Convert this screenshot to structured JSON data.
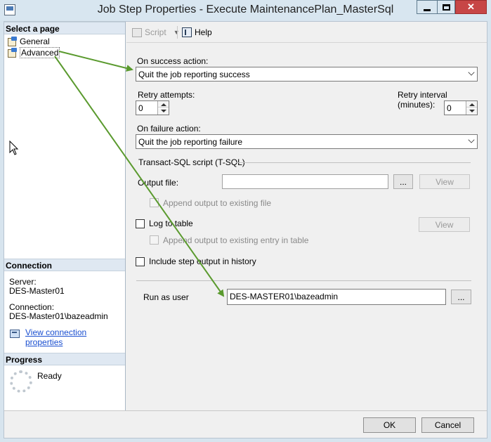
{
  "window": {
    "title": "Job Step Properties - Execute MaintenancePlan_MasterSql"
  },
  "left": {
    "select_page_header": "Select a page",
    "pages": [
      {
        "label": "General"
      },
      {
        "label": "Advanced"
      }
    ],
    "connection_header": "Connection",
    "server_label": "Server:",
    "server_value": "DES-Master01",
    "connection_label": "Connection:",
    "connection_value": "DES-Master01\\bazeadmin",
    "view_props_link": "View connection properties",
    "progress_header": "Progress",
    "progress_status": "Ready"
  },
  "toolbar": {
    "script_label": "Script",
    "help_label": "Help"
  },
  "form": {
    "on_success_label": "On success action:",
    "on_success_value": "Quit the job reporting success",
    "retry_attempts_label": "Retry attempts:",
    "retry_attempts_value": "0",
    "retry_interval_label": "Retry interval (minutes):",
    "retry_interval_value": "0",
    "on_failure_label": "On failure action:",
    "on_failure_value": "Quit the job reporting failure",
    "tsql_section": "Transact-SQL script (T-SQL)",
    "output_file_label": "Output file:",
    "output_file_value": "",
    "browse_label": "...",
    "view_label": "View",
    "append_output_label": "Append output to existing file",
    "log_to_table_label": "Log to table",
    "view_table_label": "View",
    "append_table_label": "Append output to existing entry in table",
    "include_history_label": "Include step output in history",
    "run_as_label": "Run as user",
    "run_as_value": "DES-MASTER01\\bazeadmin",
    "run_as_browse": "..."
  },
  "buttons": {
    "ok": "OK",
    "cancel": "Cancel"
  },
  "colors": {
    "annotation_arrow": "#5a9a2e",
    "link": "#1a4fd0",
    "close_button": "#c74646"
  }
}
